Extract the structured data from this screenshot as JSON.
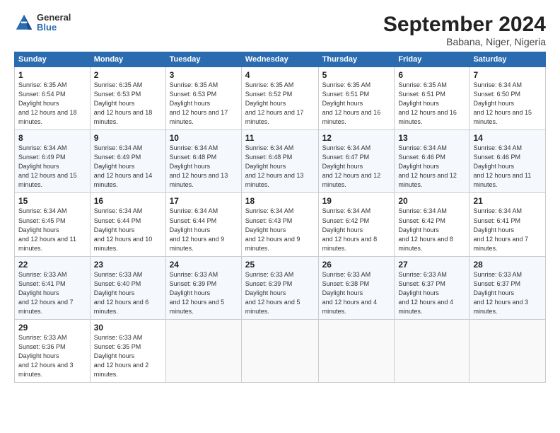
{
  "header": {
    "logo_general": "General",
    "logo_blue": "Blue",
    "month_title": "September 2024",
    "location": "Babana, Niger, Nigeria"
  },
  "days_of_week": [
    "Sunday",
    "Monday",
    "Tuesday",
    "Wednesday",
    "Thursday",
    "Friday",
    "Saturday"
  ],
  "weeks": [
    [
      {
        "day": "1",
        "sunrise": "6:35 AM",
        "sunset": "6:54 PM",
        "daylight": "12 hours and 18 minutes."
      },
      {
        "day": "2",
        "sunrise": "6:35 AM",
        "sunset": "6:53 PM",
        "daylight": "12 hours and 18 minutes."
      },
      {
        "day": "3",
        "sunrise": "6:35 AM",
        "sunset": "6:53 PM",
        "daylight": "12 hours and 17 minutes."
      },
      {
        "day": "4",
        "sunrise": "6:35 AM",
        "sunset": "6:52 PM",
        "daylight": "12 hours and 17 minutes."
      },
      {
        "day": "5",
        "sunrise": "6:35 AM",
        "sunset": "6:51 PM",
        "daylight": "12 hours and 16 minutes."
      },
      {
        "day": "6",
        "sunrise": "6:35 AM",
        "sunset": "6:51 PM",
        "daylight": "12 hours and 16 minutes."
      },
      {
        "day": "7",
        "sunrise": "6:34 AM",
        "sunset": "6:50 PM",
        "daylight": "12 hours and 15 minutes."
      }
    ],
    [
      {
        "day": "8",
        "sunrise": "6:34 AM",
        "sunset": "6:49 PM",
        "daylight": "12 hours and 15 minutes."
      },
      {
        "day": "9",
        "sunrise": "6:34 AM",
        "sunset": "6:49 PM",
        "daylight": "12 hours and 14 minutes."
      },
      {
        "day": "10",
        "sunrise": "6:34 AM",
        "sunset": "6:48 PM",
        "daylight": "12 hours and 13 minutes."
      },
      {
        "day": "11",
        "sunrise": "6:34 AM",
        "sunset": "6:48 PM",
        "daylight": "12 hours and 13 minutes."
      },
      {
        "day": "12",
        "sunrise": "6:34 AM",
        "sunset": "6:47 PM",
        "daylight": "12 hours and 12 minutes."
      },
      {
        "day": "13",
        "sunrise": "6:34 AM",
        "sunset": "6:46 PM",
        "daylight": "12 hours and 12 minutes."
      },
      {
        "day": "14",
        "sunrise": "6:34 AM",
        "sunset": "6:46 PM",
        "daylight": "12 hours and 11 minutes."
      }
    ],
    [
      {
        "day": "15",
        "sunrise": "6:34 AM",
        "sunset": "6:45 PM",
        "daylight": "12 hours and 11 minutes."
      },
      {
        "day": "16",
        "sunrise": "6:34 AM",
        "sunset": "6:44 PM",
        "daylight": "12 hours and 10 minutes."
      },
      {
        "day": "17",
        "sunrise": "6:34 AM",
        "sunset": "6:44 PM",
        "daylight": "12 hours and 9 minutes."
      },
      {
        "day": "18",
        "sunrise": "6:34 AM",
        "sunset": "6:43 PM",
        "daylight": "12 hours and 9 minutes."
      },
      {
        "day": "19",
        "sunrise": "6:34 AM",
        "sunset": "6:42 PM",
        "daylight": "12 hours and 8 minutes."
      },
      {
        "day": "20",
        "sunrise": "6:34 AM",
        "sunset": "6:42 PM",
        "daylight": "12 hours and 8 minutes."
      },
      {
        "day": "21",
        "sunrise": "6:34 AM",
        "sunset": "6:41 PM",
        "daylight": "12 hours and 7 minutes."
      }
    ],
    [
      {
        "day": "22",
        "sunrise": "6:33 AM",
        "sunset": "6:41 PM",
        "daylight": "12 hours and 7 minutes."
      },
      {
        "day": "23",
        "sunrise": "6:33 AM",
        "sunset": "6:40 PM",
        "daylight": "12 hours and 6 minutes."
      },
      {
        "day": "24",
        "sunrise": "6:33 AM",
        "sunset": "6:39 PM",
        "daylight": "12 hours and 5 minutes."
      },
      {
        "day": "25",
        "sunrise": "6:33 AM",
        "sunset": "6:39 PM",
        "daylight": "12 hours and 5 minutes."
      },
      {
        "day": "26",
        "sunrise": "6:33 AM",
        "sunset": "6:38 PM",
        "daylight": "12 hours and 4 minutes."
      },
      {
        "day": "27",
        "sunrise": "6:33 AM",
        "sunset": "6:37 PM",
        "daylight": "12 hours and 4 minutes."
      },
      {
        "day": "28",
        "sunrise": "6:33 AM",
        "sunset": "6:37 PM",
        "daylight": "12 hours and 3 minutes."
      }
    ],
    [
      {
        "day": "29",
        "sunrise": "6:33 AM",
        "sunset": "6:36 PM",
        "daylight": "12 hours and 3 minutes."
      },
      {
        "day": "30",
        "sunrise": "6:33 AM",
        "sunset": "6:35 PM",
        "daylight": "12 hours and 2 minutes."
      },
      null,
      null,
      null,
      null,
      null
    ]
  ]
}
